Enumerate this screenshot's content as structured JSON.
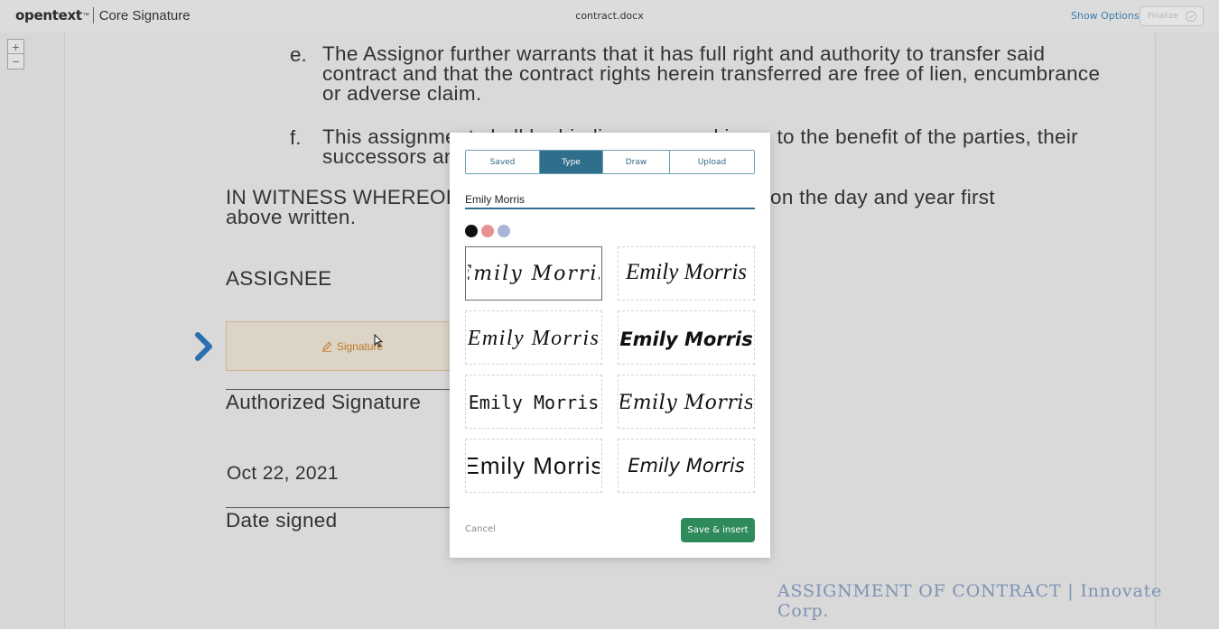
{
  "header": {
    "brand": "opentext",
    "brand_tm": "™",
    "product": "Core Signature",
    "document_title": "contract.docx",
    "show_options": "Show Options",
    "finalize": "Finalize"
  },
  "zoom": {
    "in": "+",
    "out": "−"
  },
  "document": {
    "items": [
      {
        "marker": "e.",
        "lines": [
          "The Assignor further warrants that it has full right and authority to transfer said",
          "contract and that the contract rights herein transferred are free of lien, encumbrance",
          "or adverse claim."
        ]
      },
      {
        "marker": "f.",
        "lines": [
          "This assignment shall be binding upon and inure to the benefit of the parties, their",
          "successors and"
        ]
      }
    ],
    "witness_lines": [
      "IN WITNESS WHEREOF, the",
      "on the day and year first",
      "above written."
    ],
    "assignee": "ASSIGNEE",
    "signature_field": "Signature",
    "authorized_signature": "Authorized Signature",
    "date_value": "Oct 22, 2021",
    "date_signed": "Date signed",
    "footer": "ASSIGNMENT OF CONTRACT | Innovate Corp."
  },
  "signature_dialog": {
    "tabs": [
      "Saved",
      "Type",
      "Draw",
      "Upload"
    ],
    "active_tab": "Type",
    "name_value": "Emily Morris",
    "colors": [
      "#111111",
      "#e99090",
      "#a9b4d6"
    ],
    "options_text": [
      "Emily Morris",
      "Emily Morris",
      "Emily Morris",
      "Emily Morris",
      "Emily Morris",
      "Emily Morris",
      "Emily Morris",
      "Emily Morris"
    ],
    "selected_index": 0,
    "cancel": "Cancel",
    "save": "Save & insert"
  }
}
